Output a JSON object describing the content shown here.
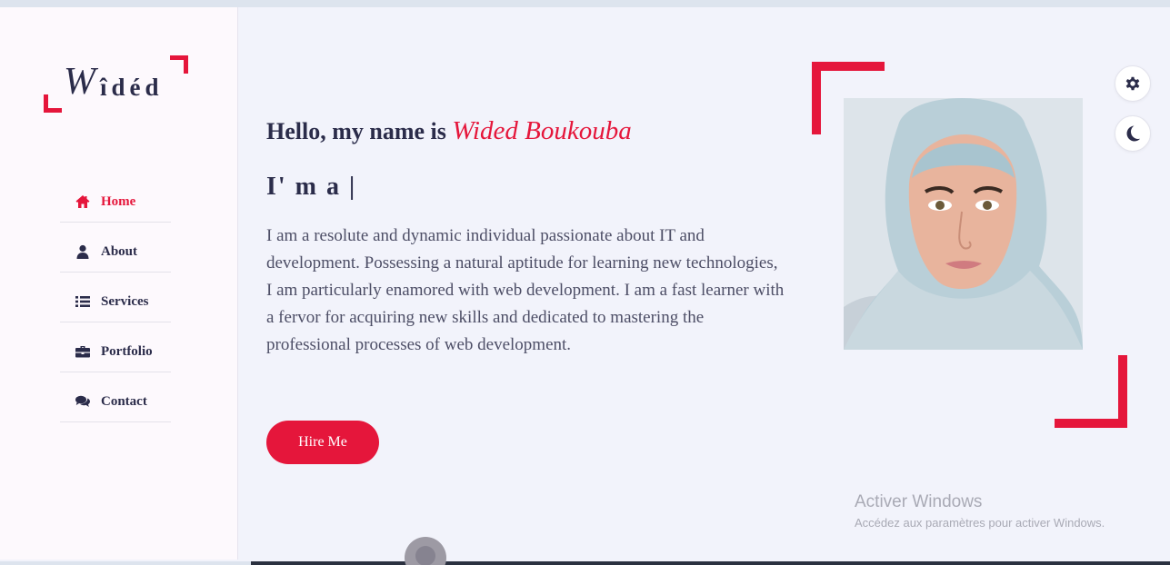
{
  "logo": {
    "first_letter": "W",
    "rest": "îdéd"
  },
  "nav": {
    "items": [
      {
        "label": "Home",
        "icon": "home-icon",
        "active": true
      },
      {
        "label": "About",
        "icon": "user-icon",
        "active": false
      },
      {
        "label": "Services",
        "icon": "list-icon",
        "active": false
      },
      {
        "label": "Portfolio",
        "icon": "briefcase-icon",
        "active": false
      },
      {
        "label": "Contact",
        "icon": "comments-icon",
        "active": false
      }
    ]
  },
  "hero": {
    "greeting": "Hello, my name is ",
    "name": "Wided Boukouba",
    "typing_text": "I' m a |",
    "description": "I am a resolute and dynamic individual passionate about IT and development. Possessing a natural aptitude for learning new technologies, I am particularly enamored with web development. I am a fast learner with a fervor for acquiring new skills and dedicated to mastering the professional processes of web development.",
    "hire_button": "Hire Me"
  },
  "controls": {
    "settings_icon": "gear-icon",
    "theme_icon": "moon-icon"
  },
  "watermark": {
    "title": "Activer Windows",
    "subtitle": "Accédez aux paramètres pour activer Windows."
  },
  "colors": {
    "accent": "#e5163b",
    "text": "#2b2c4a",
    "background": "#f2f3fb",
    "sidebar": "#fdf9fd"
  }
}
